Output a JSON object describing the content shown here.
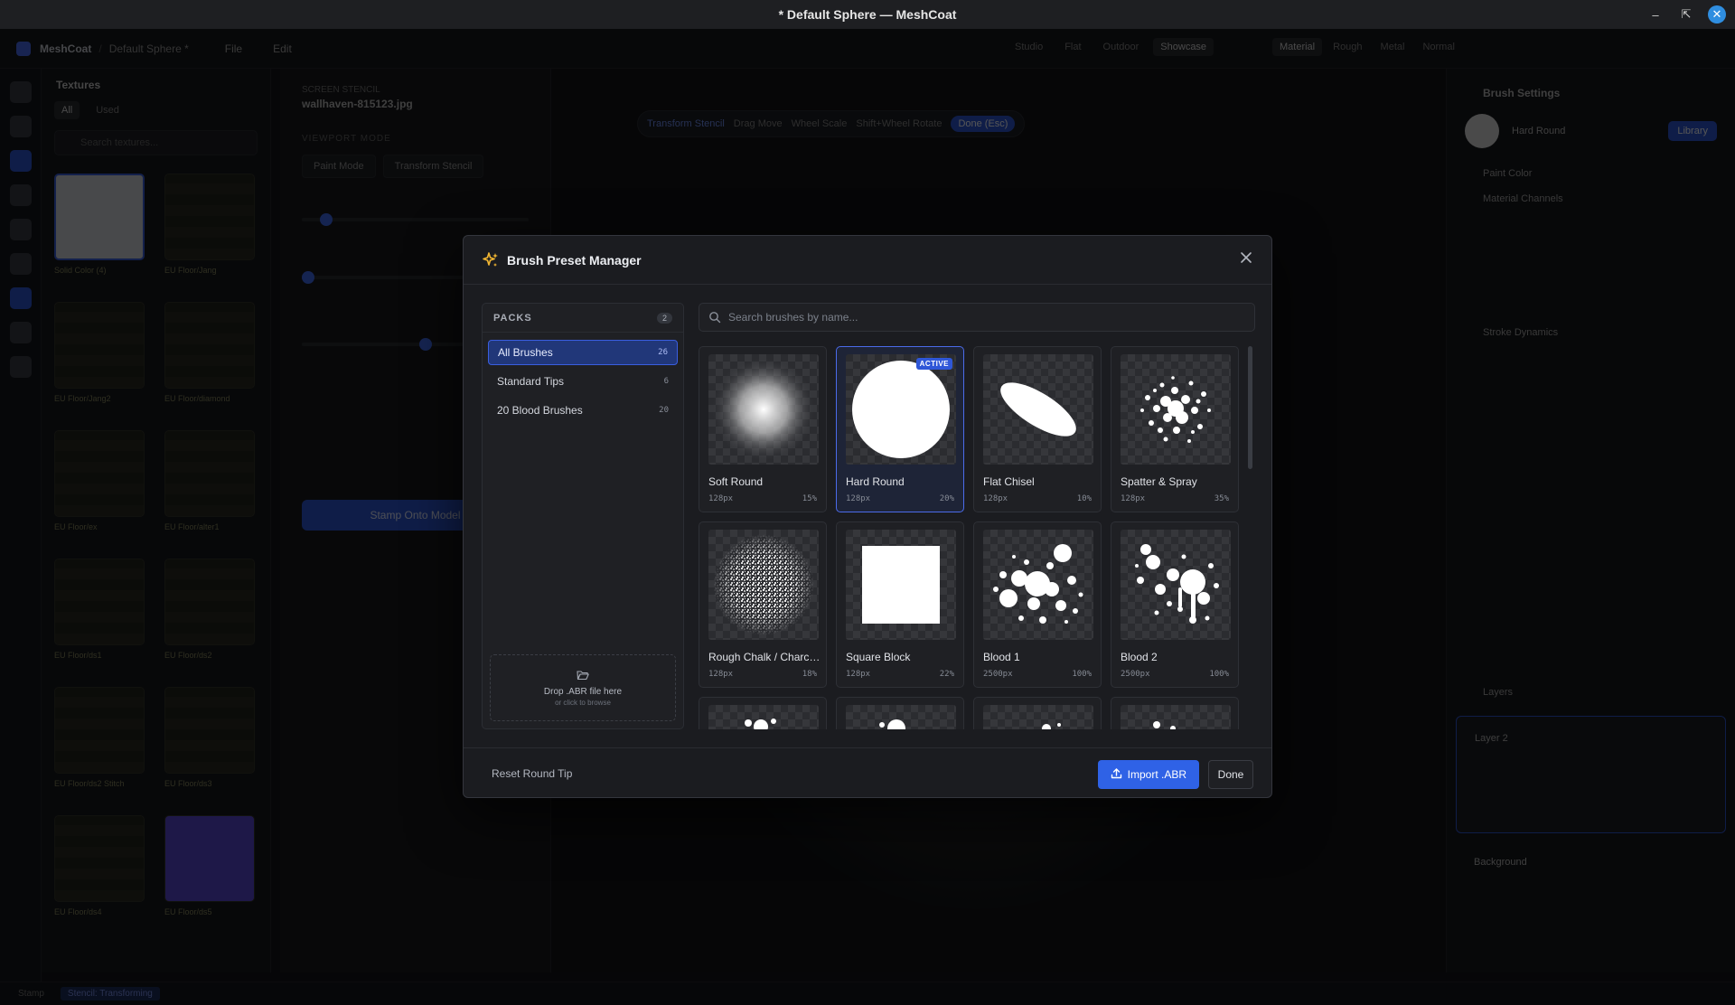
{
  "window": {
    "title": "* Default Sphere — MeshCoat"
  },
  "app": {
    "name": "MeshCoat",
    "document": "Default Sphere *",
    "menus": [
      "File",
      "Edit"
    ],
    "modes": [
      "Studio",
      "Flat",
      "Outdoor",
      "Showcase"
    ],
    "channels": [
      "Material",
      "Rough",
      "Metal",
      "Normal"
    ],
    "textures": {
      "title": "Textures",
      "tabs": [
        "All",
        "Used"
      ],
      "search_placeholder": "Search textures...",
      "items": [
        "Solid Color (4)",
        "EU Floor/Jang",
        "EU Floor/Jang2",
        "EU Floor/diamond",
        "EU Floor/ex",
        "EU Floor/alter1",
        "EU Floor/ds1",
        "EU Floor/ds2",
        "EU Floor/ds2 Stitch",
        "EU Floor/ds3",
        "EU Floor/ds4",
        "EU Floor/ds5"
      ]
    },
    "stencil": {
      "label": "SCREEN STENCIL",
      "file": "wallhaven-815123.jpg",
      "section_mode": "VIEWPORT MODE",
      "btn_paint": "Paint Mode",
      "btn_transform": "Transform Stencil",
      "stamp": "Stamp Onto Model"
    },
    "viewport": {
      "transform": "Transform Stencil",
      "drag": "Drag Move",
      "wheel": "Wheel Scale",
      "shift_wheel": "Shift+Wheel Rotate",
      "done": "Done (Esc)"
    },
    "right": {
      "brush_settings": "Brush Settings",
      "brush_name": "Hard Round",
      "library": "Library",
      "paint_color": "Paint Color",
      "material_channels": "Material Channels",
      "stroke_dynamics": "Stroke Dynamics",
      "layers": "Layers",
      "layer2": "Layer 2",
      "background": "Background"
    },
    "status": {
      "mode": "Stamp",
      "transforming": "Stencil: Transforming"
    }
  },
  "modal": {
    "title": "Brush Preset Manager",
    "packs": {
      "title": "PACKS",
      "count": "2",
      "items": [
        {
          "name": "All Brushes",
          "count": "26"
        },
        {
          "name": "Standard Tips",
          "count": "6"
        },
        {
          "name": "20 Blood Brushes",
          "count": "20"
        }
      ]
    },
    "dropzone": {
      "main": "Drop .ABR file here",
      "sub": "or click to browse"
    },
    "search": {
      "placeholder": "Search brushes by name..."
    },
    "active_badge": "ACTIVE",
    "brushes": [
      {
        "name": "Soft Round",
        "size": "128px",
        "spacing": "15%",
        "icon": "soft-round"
      },
      {
        "name": "Hard Round",
        "size": "128px",
        "spacing": "20%",
        "icon": "hard-round",
        "active": true
      },
      {
        "name": "Flat Chisel",
        "size": "128px",
        "spacing": "10%",
        "icon": "flat-chisel"
      },
      {
        "name": "Spatter & Spray",
        "size": "128px",
        "spacing": "35%",
        "icon": "spatter"
      },
      {
        "name": "Rough Chalk / Charcoal",
        "size": "128px",
        "spacing": "18%",
        "icon": "chalk"
      },
      {
        "name": "Square Block",
        "size": "128px",
        "spacing": "22%",
        "icon": "square"
      },
      {
        "name": "Blood 1",
        "size": "2500px",
        "spacing": "100%",
        "icon": "blood"
      },
      {
        "name": "Blood 2",
        "size": "2500px",
        "spacing": "100%",
        "icon": "blood"
      }
    ],
    "footer": {
      "reset": "Reset Round Tip",
      "import": "Import .ABR",
      "done": "Done"
    }
  }
}
